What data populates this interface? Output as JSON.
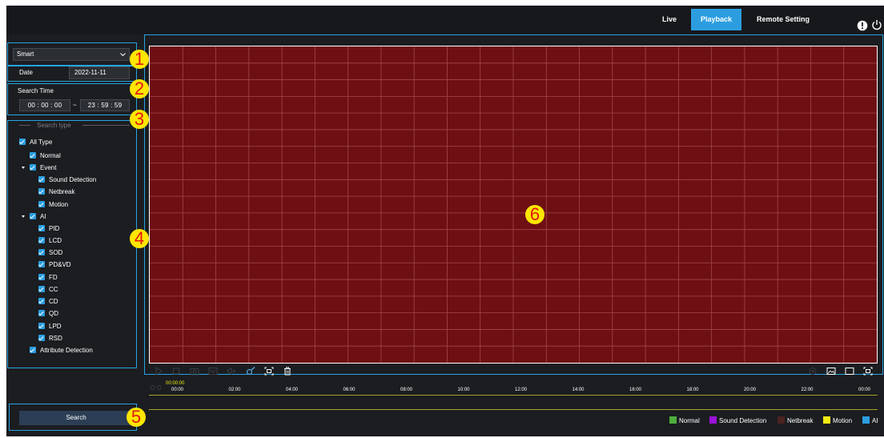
{
  "nav": {
    "tabs": [
      {
        "label": "Live"
      },
      {
        "label": "Playback"
      },
      {
        "label": "Remote Setting"
      }
    ]
  },
  "sidebar": {
    "mode_select": "Smart",
    "date_label": "Date",
    "date_value": "2022-11-11",
    "search_time_label": "Search Time",
    "start_time": "00 : 00 : 00",
    "time_separator": "~",
    "end_time": "23 : 59 : 59",
    "search_type_legend": "Search type",
    "tree": [
      "All Type",
      "Normal",
      "Event",
      "Sound Detection",
      "Netbreak",
      "Motion",
      "AI",
      "PID",
      "LCD",
      "SOD",
      "PD&VD",
      "FD",
      "CC",
      "CD",
      "QD",
      "LPD",
      "RSD",
      "Attribute Detection"
    ],
    "search_button": "Search"
  },
  "badges": [
    "1",
    "2",
    "3",
    "4",
    "5",
    "6"
  ],
  "timeline": {
    "cursor_time": "00:00:00",
    "ticks": [
      "00:00",
      "02:00",
      "04:00",
      "06:00",
      "08:00",
      "10:00",
      "12:00",
      "14:00",
      "16:00",
      "18:00",
      "20:00",
      "22:00",
      "00:00"
    ]
  },
  "legend": [
    {
      "label": "Normal",
      "color": "#4caf3c"
    },
    {
      "label": "Sound Detection",
      "color": "#9b12d8"
    },
    {
      "label": "Netbreak",
      "color": "#4a2320"
    },
    {
      "label": "Motion",
      "color": "#f2ea14"
    },
    {
      "label": "AI",
      "color": "#2c9ee0"
    }
  ],
  "colors": {
    "accent": "#2c9ee0",
    "video_bg": "#6e0f14",
    "badge": "#ffe600",
    "badge_text": "#e0170f"
  }
}
